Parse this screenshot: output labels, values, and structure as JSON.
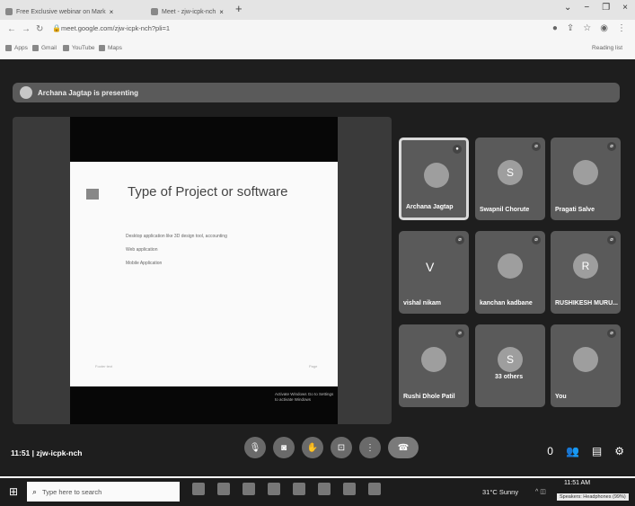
{
  "browser": {
    "tabs": [
      {
        "label": "Free Exclusive webinar on Mark"
      },
      {
        "label": "Meet - zjw-icpk-nch"
      }
    ],
    "url": "meet.google.com/zjw-icpk-nch?pli=1",
    "bookmarks": [
      {
        "label": "Apps"
      },
      {
        "label": "Gmail"
      },
      {
        "label": "YouTube"
      },
      {
        "label": "Maps"
      }
    ],
    "reading_list": "Reading list"
  },
  "meet": {
    "presenting_banner": "Archana Jagtap is presenting",
    "meeting_time": "11:51",
    "meeting_code": "zjw-icpk-nch",
    "info_count": "0"
  },
  "slide": {
    "title": "Type of Project or software",
    "bullets": [
      "Desktop application like 3D design tool, accounting",
      "Web application",
      "Mobile Application"
    ],
    "footer_left": "Footer text",
    "footer_right": "Page",
    "caption": "Activate Windows Go to Settings to activate Windows"
  },
  "participants": [
    {
      "name": "Archana Jagtap",
      "initial": "",
      "active": true
    },
    {
      "name": "Swapnil Chorute",
      "initial": "S",
      "active": false
    },
    {
      "name": "Pragati Salve",
      "initial": "",
      "active": false
    },
    {
      "name": "vishal nikam",
      "initial": "V",
      "active": false
    },
    {
      "name": "kanchan kadbane",
      "initial": "",
      "active": false
    },
    {
      "name": "RUSHIKESH MURU...",
      "initial": "R",
      "active": false
    },
    {
      "name": "Rushi Dhole Patil",
      "initial": "",
      "active": false
    },
    {
      "name": "33 others",
      "initial": "S",
      "active": false
    },
    {
      "name": "You",
      "initial": "",
      "active": false
    }
  ],
  "taskbar": {
    "search_placeholder": "Type here to search",
    "weather": "31°C Sunny",
    "clock": "11:51 AM",
    "tooltip": "Speakers: Headphones (99%)"
  }
}
